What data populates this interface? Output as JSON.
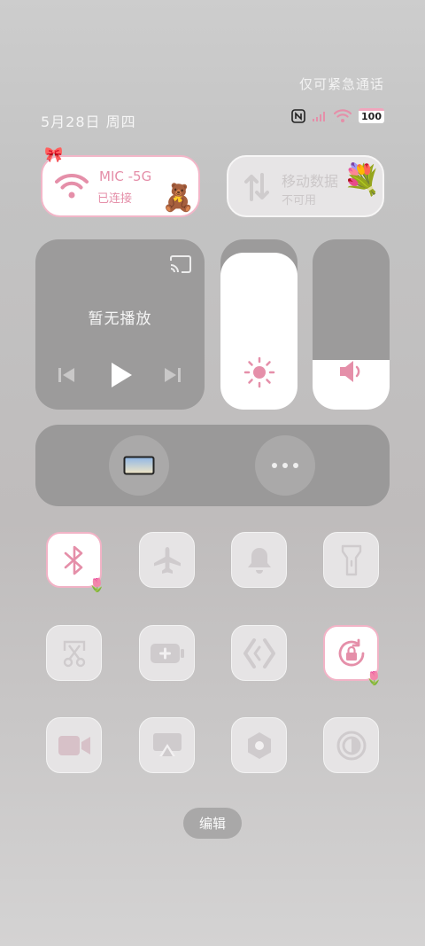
{
  "status_bar": {
    "emergency_text": "仅可紧急通话",
    "date": "5月28日 周四",
    "battery": "100",
    "icons": [
      "nfc-icon",
      "signal-icon",
      "wifi-icon",
      "battery-icon"
    ]
  },
  "wifi_tile": {
    "name": "MIC -5G",
    "status": "已连接"
  },
  "mobile_tile": {
    "title": "移动数据",
    "status": "不可用"
  },
  "media": {
    "title": "暂无播放"
  },
  "sliders": {
    "brightness_level": 0.92,
    "volume_level": 0.29
  },
  "toggles": [
    {
      "name": "bluetooth",
      "on": true
    },
    {
      "name": "airplane-mode",
      "on": false
    },
    {
      "name": "sound",
      "on": false
    },
    {
      "name": "flashlight",
      "on": false
    },
    {
      "name": "screenshot",
      "on": false
    },
    {
      "name": "battery-saver",
      "on": false
    },
    {
      "name": "code-dev",
      "on": false
    },
    {
      "name": "rotation-lock",
      "on": true
    },
    {
      "name": "screen-record",
      "on": false
    },
    {
      "name": "screen-cast",
      "on": false
    },
    {
      "name": "settings",
      "on": false
    },
    {
      "name": "dark-mode",
      "on": false
    }
  ],
  "edit_label": "编辑",
  "colors": {
    "accent_pink": "#e58fa9",
    "tile_grey": "#9c9b9b",
    "white": "#ffffff"
  }
}
